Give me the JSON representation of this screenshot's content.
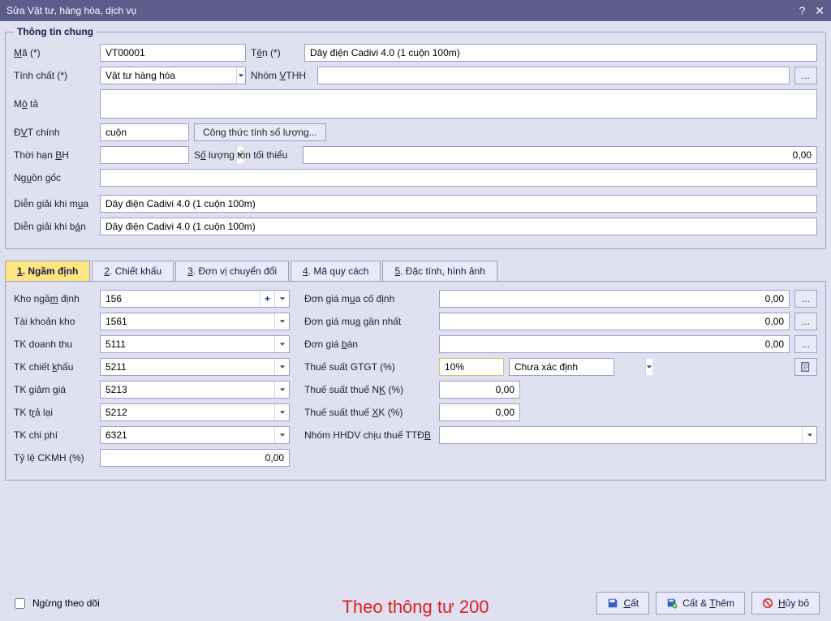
{
  "window": {
    "title": "Sửa Vật tư, hàng hóa, dịch vụ"
  },
  "group1": {
    "legend": "Thông tin chung"
  },
  "labels": {
    "ma": "Mã (*)",
    "ten": "Tên (*)",
    "tinhchat": "Tính chất (*)",
    "nhomvthh": "Nhóm VTHH",
    "mota": "Mô tả",
    "dvtchinh": "ĐVT chính",
    "congthuc": "Công thức tính số lượng...",
    "thoihanbh": "Thời hạn BH",
    "soluongton": "Số lượng tồn tối thiểu",
    "nguongoc": "Nguồn gốc",
    "diengiai_mua": "Diễn giải khi mua",
    "diengiai_ban": "Diễn giải khi bán",
    "ngungtheodoi": "Ngừng theo dõi"
  },
  "values": {
    "ma": "VT00001",
    "ten": "Dây điện Cadivi 4.0 (1 cuộn 100m)",
    "tinhchat": "Vật tư hàng hóa",
    "nhomvthh": "",
    "mota": "",
    "dvtchinh": "cuộn",
    "thoihanbh": "",
    "soluongton": "0,00",
    "nguongoc": "",
    "diengiai_mua": "Dây điện Cadivi 4.0 (1 cuộn 100m)",
    "diengiai_ban": "Dây điện Cadivi 4.0 (1 cuộn 100m)"
  },
  "tabs": {
    "t1": "1. Ngầm định",
    "t2": "2. Chiết khấu",
    "t3": "3. Đơn vị chuyển đổi",
    "t4": "4. Mã quy cách",
    "t5": "5. Đặc tính, hình ảnh"
  },
  "default_tab": {
    "labels": {
      "kho": "Kho ngầm định",
      "tkkho": "Tài khoản kho",
      "tkdoanhthu": "TK doanh thu",
      "tkchietkhau": "TK chiết khấu",
      "tkgiamgia": "TK giảm giá",
      "tktralai": "TK trả lại",
      "tkchiphi": "TK chi phí",
      "tyleckmh": "Tỷ lệ CKMH (%)",
      "dongia_mua_cd": "Đơn giá mua cố định",
      "dongia_mua_gn": "Đơn giá mua gần nhất",
      "dongia_ban": "Đơn giá bán",
      "thuesuatgtgt": "Thuế suất GTGT (%)",
      "thuesuatnk": "Thuế suất thuế NK (%)",
      "thuesuatxk": "Thuế suất thuế XK (%)",
      "nhomhhdv": "Nhóm HHDV chịu thuế TTĐB"
    },
    "values": {
      "kho": "156",
      "tkkho": "1561",
      "tkdoanhthu": "5111",
      "tkchietkhau": "5211",
      "tkgiamgia": "5213",
      "tktralai": "5212",
      "tkchiphi": "6321",
      "tyleckmh": "0,00",
      "dongia_mua_cd": "0,00",
      "dongia_mua_gn": "0,00",
      "dongia_ban": "0,00",
      "thuesuatgtgt": "10%",
      "thuesuatgtgt_status": "Chưa xác định",
      "thuesuatnk": "0,00",
      "thuesuatxk": "0,00",
      "nhomhhdv": ""
    }
  },
  "buttons": {
    "cat": "Cất",
    "catthem": "Cất & Thêm",
    "huybo": "Hủy bỏ"
  },
  "annotation": "Theo thông tư 200"
}
